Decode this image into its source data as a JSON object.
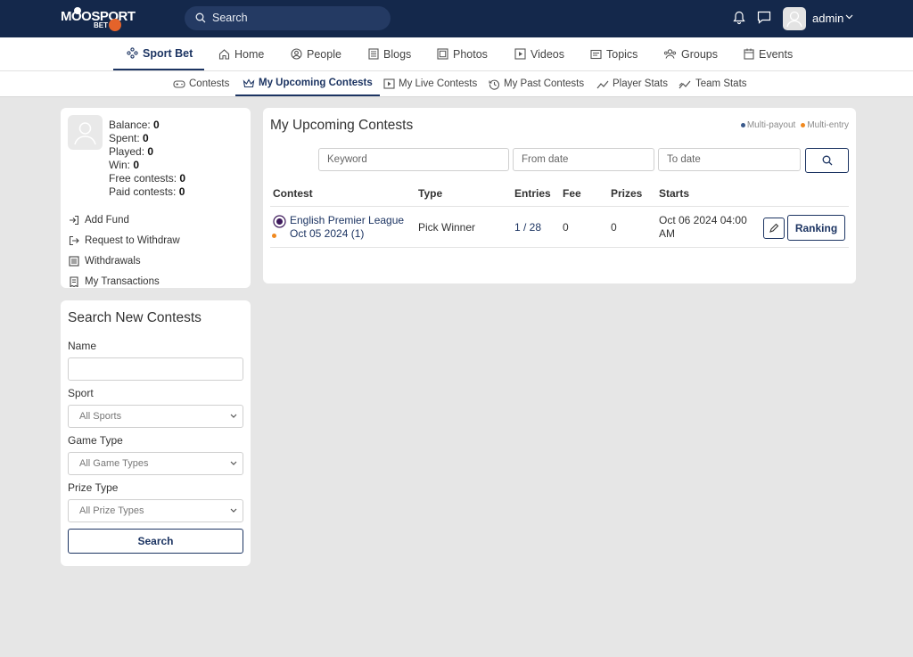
{
  "brand": {
    "logo_main": "MOOSPORT",
    "logo_sub": "BET"
  },
  "search": {
    "placeholder": "Search"
  },
  "user": {
    "name": "admin"
  },
  "main_nav": [
    {
      "label": "Sport Bet",
      "icon": "sport-bet-icon",
      "active": true
    },
    {
      "label": "Home",
      "icon": "home-icon"
    },
    {
      "label": "People",
      "icon": "people-icon"
    },
    {
      "label": "Blogs",
      "icon": "blogs-icon"
    },
    {
      "label": "Photos",
      "icon": "photos-icon"
    },
    {
      "label": "Videos",
      "icon": "videos-icon"
    },
    {
      "label": "Topics",
      "icon": "topics-icon"
    },
    {
      "label": "Groups",
      "icon": "groups-icon"
    },
    {
      "label": "Events",
      "icon": "events-icon"
    }
  ],
  "sub_nav": [
    {
      "label": "Contests",
      "icon": "gamepad-icon"
    },
    {
      "label": "My Upcoming Contests",
      "icon": "crown-icon",
      "active": true
    },
    {
      "label": "My Live Contests",
      "icon": "play-icon"
    },
    {
      "label": "My Past Contests",
      "icon": "history-icon"
    },
    {
      "label": "Player Stats",
      "icon": "trend-icon"
    },
    {
      "label": "Team Stats",
      "icon": "trend-icon"
    }
  ],
  "balance": {
    "rows": [
      {
        "label": "Balance:",
        "value": "0"
      },
      {
        "label": "Spent:",
        "value": "0"
      },
      {
        "label": "Played:",
        "value": "0"
      },
      {
        "label": "Win:",
        "value": "0"
      },
      {
        "label": "Free contests:",
        "value": "0"
      },
      {
        "label": "Paid contests:",
        "value": "0"
      }
    ],
    "actions": [
      "Add Fund",
      "Request to Withdraw",
      "Withdrawals",
      "My Transactions"
    ]
  },
  "search_contests": {
    "title": "Search New Contests",
    "name_label": "Name",
    "sport_label": "Sport",
    "sport_value": "All Sports",
    "game_type_label": "Game Type",
    "game_type_value": "All Game Types",
    "prize_type_label": "Prize Type",
    "prize_type_value": "All Prize Types",
    "button": "Search"
  },
  "upcoming": {
    "title": "My Upcoming Contests",
    "legend": [
      {
        "label": "Multi-payout",
        "color": "#3a5a8c"
      },
      {
        "label": "Multi-entry",
        "color": "#f0891f"
      }
    ],
    "filters": {
      "keyword": "Keyword",
      "from_date": "From date",
      "to_date": "To date"
    },
    "columns": [
      "Contest",
      "Type",
      "Entries",
      "Fee",
      "Prizes",
      "Starts"
    ],
    "rows": [
      {
        "league": "English Premier League",
        "date": "Oct 05 2024 (1)",
        "type": "Pick Winner",
        "entries": "1 / 28",
        "fee": "0",
        "prizes": "0",
        "starts": "Oct 06 2024 04:00 AM",
        "ranking_label": "Ranking"
      }
    ]
  },
  "colors": {
    "primary": "#14284b",
    "accent": "#1c3462",
    "page_bg": "#e6e6e6"
  }
}
